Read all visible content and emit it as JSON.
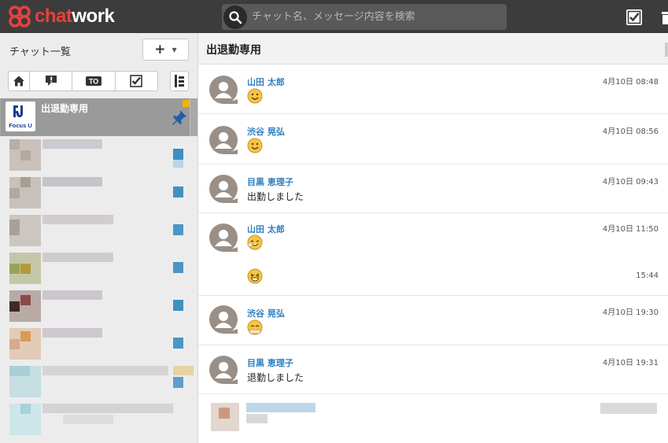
{
  "app": {
    "logo_text_chat": "chat",
    "logo_text_work": "work"
  },
  "search": {
    "placeholder": "チャット名、メッセージ内容を検索"
  },
  "sidebar": {
    "title": "チャット一覧",
    "add_label": "+",
    "filters": [
      {
        "icon": "home-icon"
      },
      {
        "icon": "unread-chat-icon"
      },
      {
        "icon": "to-mention-icon",
        "label": "TO"
      },
      {
        "icon": "task-check-icon"
      }
    ],
    "active_room": {
      "name": "出退勤専用",
      "avatar_label": "Focus U",
      "pinned": true
    }
  },
  "room": {
    "title": "出退勤専用",
    "messages": [
      {
        "sender": "山田 太郎",
        "time": "4月10日 08:48",
        "content": "emoji-smile"
      },
      {
        "sender": "渋谷 晃弘",
        "time": "4月10日 08:56",
        "content": "emoji-smile"
      },
      {
        "sender": "目黒 恵理子",
        "time": "4月10日 09:43",
        "text": "出勤しました"
      },
      {
        "sender": "山田 太郎",
        "time": "4月10日 11:50",
        "content": "emoji-wave",
        "followup_time": "15:44",
        "followup_content": "emoji-grin"
      },
      {
        "sender": "渋谷 晃弘",
        "time": "4月10日 19:30",
        "content": "emoji-bow"
      },
      {
        "sender": "目黒 恵理子",
        "time": "4月10日 19:31",
        "text": "退勤しました"
      }
    ]
  },
  "colors": {
    "header_bg": "#3c3c3c",
    "brand_red": "#e8403e",
    "sender_blue": "#2f7fbf",
    "sidebar_bg": "#ececec",
    "active_room_bg": "#9a9a9a"
  }
}
